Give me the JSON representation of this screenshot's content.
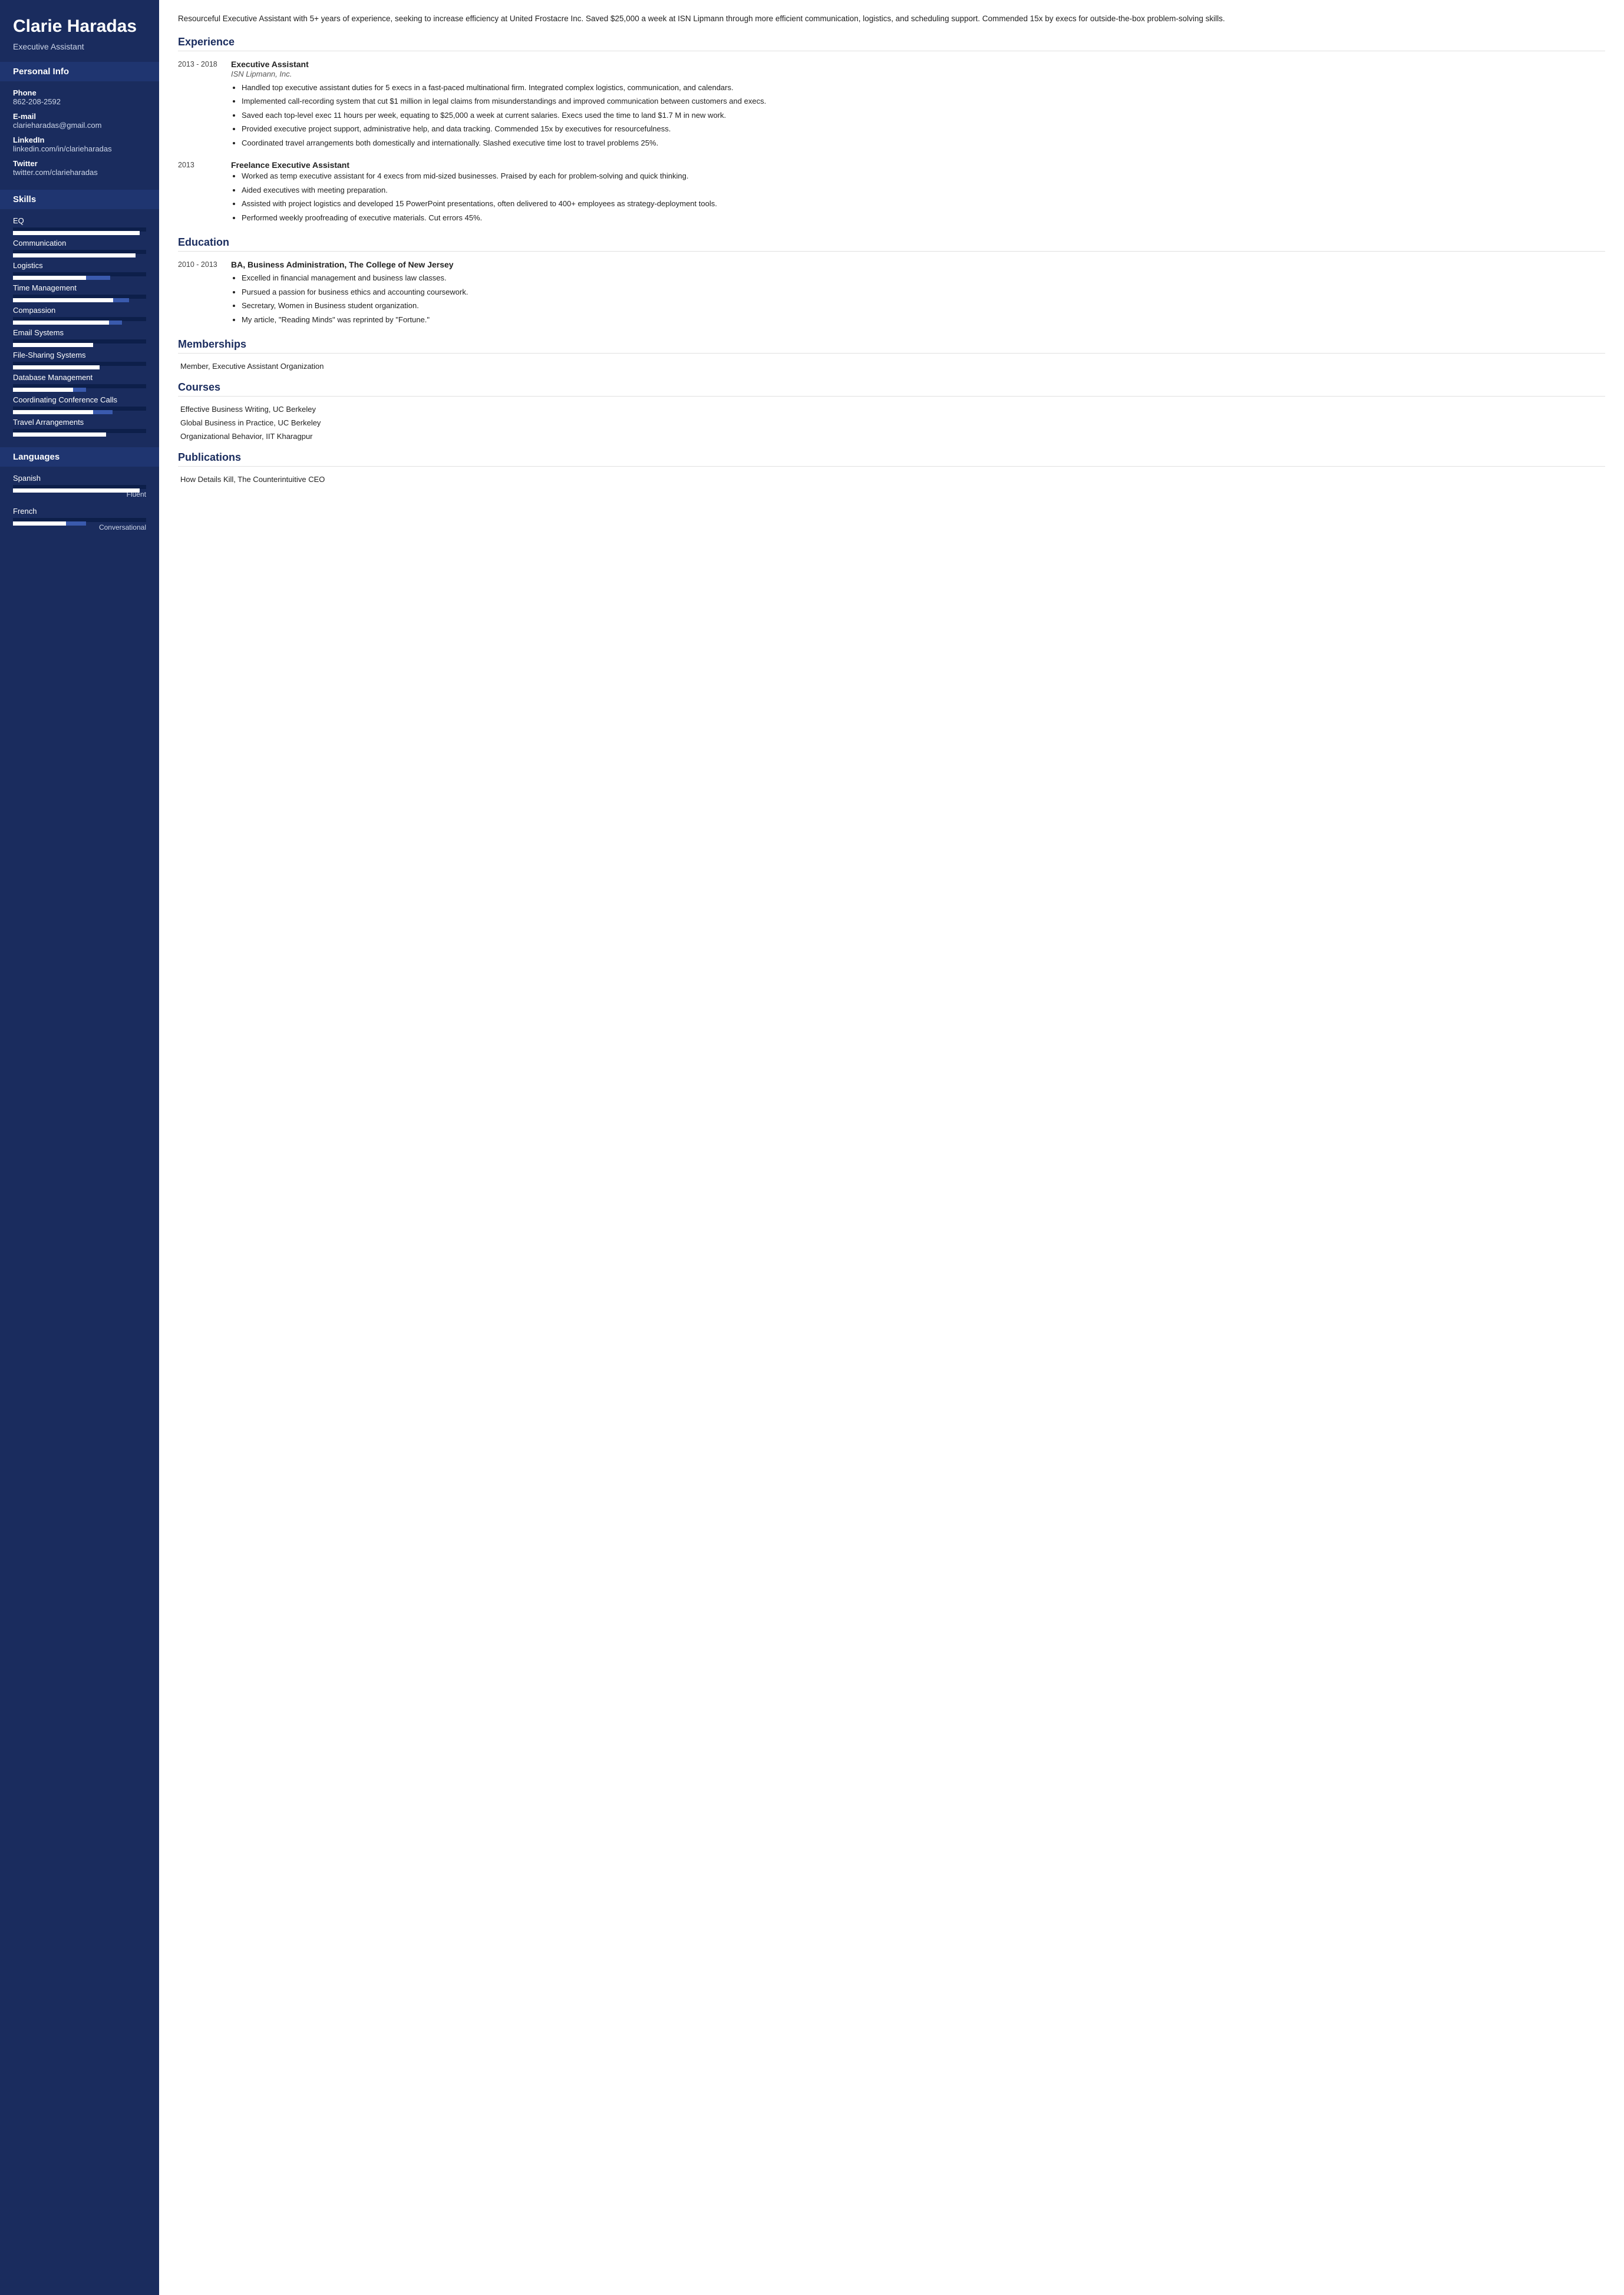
{
  "sidebar": {
    "name": "Clarie Haradas",
    "title": "Executive Assistant",
    "personal_info_title": "Personal Info",
    "personal": [
      {
        "label": "Phone",
        "value": "862-208-2592"
      },
      {
        "label": "E-mail",
        "value": "clarieharadas@gmail.com"
      },
      {
        "label": "LinkedIn",
        "value": "linkedin.com/in/clarieharadas"
      },
      {
        "label": "Twitter",
        "value": "twitter.com/clarieharadas"
      }
    ],
    "skills_title": "Skills",
    "skills": [
      {
        "label": "EQ",
        "fill": 95,
        "secondary": 0
      },
      {
        "label": "Communication",
        "fill": 92,
        "secondary": 0
      },
      {
        "label": "Logistics",
        "fill": 55,
        "secondary": 18
      },
      {
        "label": "Time Management",
        "fill": 75,
        "secondary": 12
      },
      {
        "label": "Compassion",
        "fill": 72,
        "secondary": 10
      },
      {
        "label": "Email Systems",
        "fill": 60,
        "secondary": 0
      },
      {
        "label": "File-Sharing Systems",
        "fill": 65,
        "secondary": 0
      },
      {
        "label": "Database Management",
        "fill": 45,
        "secondary": 10
      },
      {
        "label": "Coordinating Conference Calls",
        "fill": 60,
        "secondary": 15
      },
      {
        "label": "Travel Arrangements",
        "fill": 70,
        "secondary": 0
      }
    ],
    "languages_title": "Languages",
    "languages": [
      {
        "label": "Spanish",
        "fill": 95,
        "secondary": 0,
        "level": "Fluent"
      },
      {
        "label": "French",
        "fill": 40,
        "secondary": 15,
        "level": "Conversational"
      }
    ]
  },
  "main": {
    "summary": "Resourceful Executive Assistant with 5+ years of experience, seeking to increase efficiency at United Frostacre Inc. Saved $25,000 a week at ISN Lipmann through more efficient communication, logistics, and scheduling support. Commended 15x by execs for outside-the-box problem-solving skills.",
    "experience_title": "Experience",
    "experiences": [
      {
        "date": "2013 - 2018",
        "jobtitle": "Executive Assistant",
        "company": "ISN Lipmann, Inc.",
        "bullets": [
          "Handled top executive assistant duties for 5 execs in a fast-paced multinational firm. Integrated complex logistics, communication, and calendars.",
          "Implemented call-recording system that cut $1 million in legal claims from misunderstandings and improved communication between customers and execs.",
          "Saved each top-level exec 11 hours per week, equating to $25,000 a week at current salaries. Execs used the time to land $1.7 M in new work.",
          "Provided executive project support, administrative help, and data tracking. Commended 15x by executives for resourcefulness.",
          "Coordinated travel arrangements both domestically and internationally. Slashed executive time lost to travel problems 25%."
        ]
      },
      {
        "date": "2013",
        "jobtitle": "Freelance Executive Assistant",
        "company": "",
        "bullets": [
          "Worked as temp executive assistant for 4 execs from mid-sized businesses. Praised by each for problem-solving and quick thinking.",
          "Aided executives with meeting preparation.",
          "Assisted with project logistics and developed 15 PowerPoint presentations, often delivered to 400+ employees as strategy-deployment tools.",
          "Performed weekly proofreading of executive materials. Cut errors 45%."
        ]
      }
    ],
    "education_title": "Education",
    "education": [
      {
        "date": "2010 - 2013",
        "degree": "BA, Business Administration, The College of New Jersey",
        "bullets": [
          "Excelled in financial management and business law classes.",
          "Pursued a passion for business ethics and accounting coursework.",
          "Secretary, Women in Business student organization.",
          "My article, \"Reading Minds\" was reprinted by \"Fortune.\""
        ]
      }
    ],
    "memberships_title": "Memberships",
    "memberships": [
      "Member, Executive Assistant Organization"
    ],
    "courses_title": "Courses",
    "courses": [
      "Effective Business Writing, UC Berkeley",
      "Global Business in Practice, UC Berkeley",
      "Organizational Behavior, IIT Kharagpur"
    ],
    "publications_title": "Publications",
    "publications": [
      "How Details Kill, The Counterintuitive CEO"
    ]
  }
}
